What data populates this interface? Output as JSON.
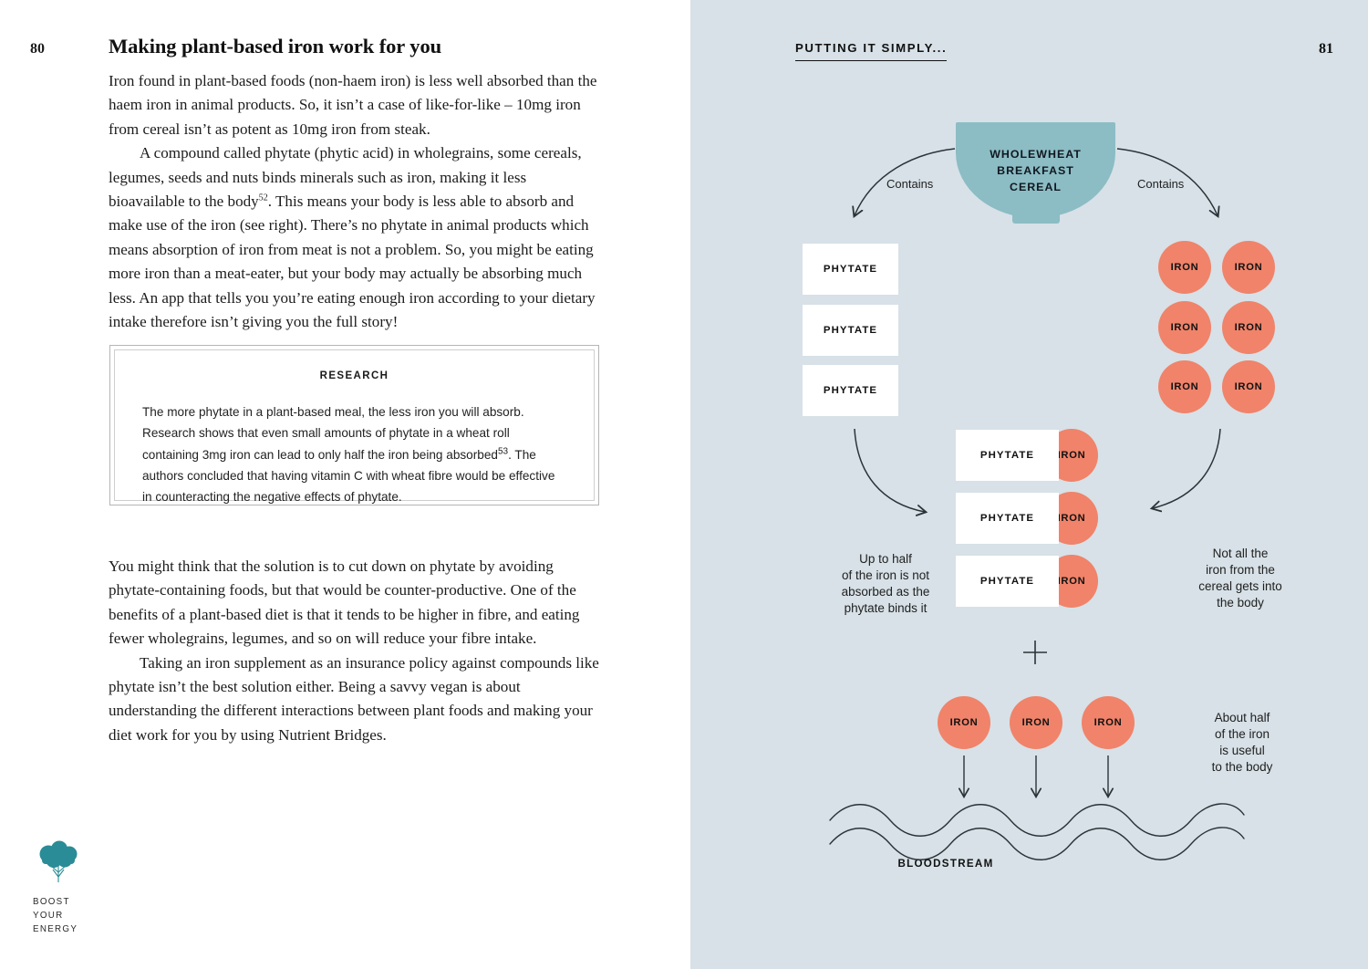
{
  "left_page": {
    "folio": "80",
    "title": "Making plant-based iron work for you",
    "paragraph_1": "Iron found in plant-based foods (non-haem iron) is less well absorbed than the haem iron in animal products. So, it isn’t a case of like-for-like – 10mg iron from cereal isn’t as potent as 10mg iron from steak.",
    "paragraph_2_a": "A compound called phytate (phytic acid) in wholegrains, some cereals, legumes, seeds and nuts binds minerals such as iron, making it less bioavailable to the body",
    "paragraph_2_sup": "52",
    "paragraph_2_b": ". This means your body is less able to absorb and make use of the iron (see right). There’s no phytate in animal products which means absorption of iron from meat is not a problem. So, you might be eating more iron than a meat-eater, but your body may actually be absorbing much less. An app that tells you you’re eating enough iron according to your dietary intake therefore isn’t giving you the full story!",
    "research_box": {
      "label": "RESEARCH",
      "text_a": "The more phytate in a plant-based meal, the less iron you will absorb. Research shows that even small amounts of phytate in a wheat roll containing 3mg iron can lead to only half the iron being absorbed",
      "text_sup": "53",
      "text_b": ". The authors concluded that having vitamin C with wheat fibre would be effective in counteracting the negative effects of phytate."
    },
    "paragraph_3": "You might think that the solution is to cut down on phytate by avoiding phytate-containing foods, but that would be counter-productive. One of the benefits of a plant-based diet is that it tends to be higher in fibre, and eating fewer wholegrains, legumes, and so on will reduce your fibre intake.",
    "paragraph_4": "Taking an iron supplement as an insurance policy against compounds like phytate isn’t the best solution either. Being a savvy vegan is about understanding the different interactions between plant foods and making your diet work for you by using Nutrient Bridges.",
    "footer_logo_line1": "BOOST",
    "footer_logo_line2": "YOUR",
    "footer_logo_line3": "ENERGY"
  },
  "right_page": {
    "folio": "81",
    "kicker": "PUTTING IT SIMPLY...",
    "bowl": {
      "line1": "WHOLEWHEAT",
      "line2": "BREAKFAST",
      "line3": "CEREAL"
    },
    "contains_left": "Contains",
    "contains_right": "Contains",
    "phytate_boxes": [
      "PHYTATE",
      "PHYTATE",
      "PHYTATE"
    ],
    "iron_circles": [
      "IRON",
      "IRON",
      "IRON",
      "IRON",
      "IRON",
      "IRON"
    ],
    "bound_pairs": [
      {
        "phytate": "PHYTATE",
        "iron": "IRON"
      },
      {
        "phytate": "PHYTATE",
        "iron": "IRON"
      },
      {
        "phytate": "PHYTATE",
        "iron": "IRON"
      }
    ],
    "caption_left": "Up to half\nof the iron is not\nabsorbed as the\nphytate binds it",
    "caption_left_lines": [
      "Up to half",
      "of the iron is not",
      "absorbed as the",
      "phytate binds it"
    ],
    "caption_right_lines": [
      "Not all the",
      "iron from the",
      "cereal gets into",
      "the body"
    ],
    "plus_symbol": "+",
    "bottom_irons": [
      "IRON",
      "IRON",
      "IRON"
    ],
    "caption_body_lines": [
      "About half",
      "of the iron",
      "is useful",
      "to the body"
    ],
    "bloodstream_label": "BLOODSTREAM"
  },
  "colors": {
    "right_page_bg": "#d7e1e7",
    "bowl_teal": "#8cbcc4",
    "iron_coral": "#f0836a",
    "logo_teal": "#2a8c96",
    "box_white": "#ffffff",
    "ink": "#111111"
  },
  "chart_data": {
    "type": "diagram",
    "title": "How phytate affects iron absorption from wholewheat breakfast cereal",
    "nodes": [
      {
        "id": "cereal",
        "label": "WHOLEWHEAT BREAKFAST CEREAL",
        "shape": "bowl",
        "color": "#8cbcc4"
      },
      {
        "id": "phytate-1",
        "label": "PHYTATE",
        "shape": "rect",
        "color": "#ffffff"
      },
      {
        "id": "phytate-2",
        "label": "PHYTATE",
        "shape": "rect",
        "color": "#ffffff"
      },
      {
        "id": "phytate-3",
        "label": "PHYTATE",
        "shape": "rect",
        "color": "#ffffff"
      },
      {
        "id": "iron-1",
        "label": "IRON",
        "shape": "circle",
        "color": "#f0836a"
      },
      {
        "id": "iron-2",
        "label": "IRON",
        "shape": "circle",
        "color": "#f0836a"
      },
      {
        "id": "iron-3",
        "label": "IRON",
        "shape": "circle",
        "color": "#f0836a"
      },
      {
        "id": "iron-4",
        "label": "IRON",
        "shape": "circle",
        "color": "#f0836a"
      },
      {
        "id": "iron-5",
        "label": "IRON",
        "shape": "circle",
        "color": "#f0836a"
      },
      {
        "id": "iron-6",
        "label": "IRON",
        "shape": "circle",
        "color": "#f0836a"
      },
      {
        "id": "bound-1",
        "label": "PHYTATE + IRON",
        "shape": "rect+circle"
      },
      {
        "id": "bound-2",
        "label": "PHYTATE + IRON",
        "shape": "rect+circle"
      },
      {
        "id": "bound-3",
        "label": "PHYTATE + IRON",
        "shape": "rect+circle"
      },
      {
        "id": "free-1",
        "label": "IRON",
        "shape": "circle",
        "color": "#f0836a"
      },
      {
        "id": "free-2",
        "label": "IRON",
        "shape": "circle",
        "color": "#f0836a"
      },
      {
        "id": "free-3",
        "label": "IRON",
        "shape": "circle",
        "color": "#f0836a"
      },
      {
        "id": "bloodstream",
        "label": "BLOODSTREAM",
        "shape": "waves"
      }
    ],
    "edges": [
      {
        "from": "cereal",
        "to": "phytate-group",
        "label": "Contains"
      },
      {
        "from": "cereal",
        "to": "iron-group",
        "label": "Contains"
      },
      {
        "from": "phytate-group",
        "to": "bound-group",
        "label": ""
      },
      {
        "from": "iron-group",
        "to": "bound-group",
        "label": ""
      },
      {
        "from": "free-irons",
        "to": "bloodstream",
        "label": ""
      }
    ],
    "annotations": [
      "Up to half of the iron is not absorbed as the phytate binds it",
      "Not all the iron from the cereal gets into the body",
      "About half of the iron is useful to the body"
    ]
  }
}
